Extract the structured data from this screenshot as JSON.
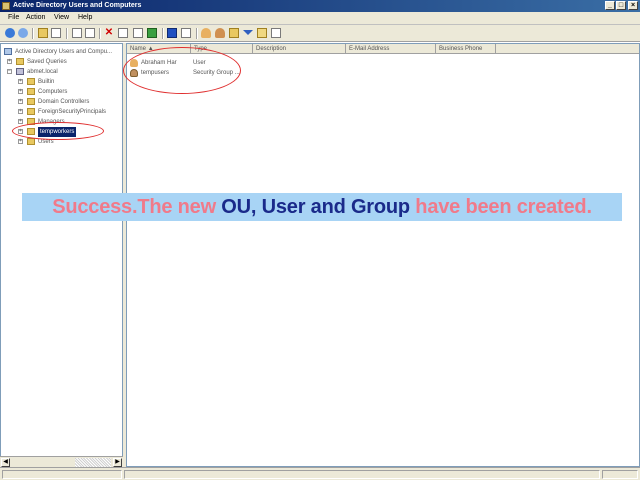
{
  "window": {
    "title": "Active Directory Users and Computers",
    "controls": {
      "minimize": "_",
      "maximize": "□",
      "close": "×"
    }
  },
  "menu": {
    "file": "File",
    "action": "Action",
    "view": "View",
    "help": "Help"
  },
  "toolbar": {
    "icons": [
      "back-arrow-icon",
      "forward-arrow-icon",
      "up-folder-icon",
      "tree-icon",
      "refresh-icon",
      "cut-icon",
      "copy-icon",
      "delete-icon",
      "properties-icon",
      "export-icon",
      "refresh2-icon",
      "help-icon",
      "console-icon",
      "new-user-icon",
      "new-group-icon",
      "new-ou-icon",
      "filter-icon",
      "find-icon",
      "move-icon"
    ]
  },
  "tree": {
    "root": "Active Directory Users and Compu...",
    "items": [
      {
        "label": "Saved Queries",
        "level": 1
      },
      {
        "label": "abmet.local",
        "level": 1
      },
      {
        "label": "Builtin",
        "level": 2
      },
      {
        "label": "Computers",
        "level": 2
      },
      {
        "label": "Domain Controllers",
        "level": 2
      },
      {
        "label": "ForeignSecurityPrincipals",
        "level": 2
      },
      {
        "label": "Managers",
        "level": 2
      },
      {
        "label": "tempworkers",
        "level": 2,
        "selected": true
      },
      {
        "label": "Users",
        "level": 2
      }
    ]
  },
  "list": {
    "columns": [
      "Name",
      "Type",
      "Description",
      "E-Mail Address",
      "Business Phone"
    ],
    "rows": [
      {
        "name": "Abraham Har",
        "type": "User",
        "icon": "user-icon"
      },
      {
        "name": "tempusers",
        "type": "Security Group ...",
        "icon": "group-icon"
      }
    ]
  },
  "banner": {
    "part1": "Success.The new ",
    "part2": "OU, User and Group",
    "part3": " have been created.",
    "colors": {
      "pink": "#f07a8a",
      "navy": "#1a2a8a",
      "background": "#a8d4f5"
    }
  },
  "colors": {
    "title_bar": "#0a246a",
    "selection": "#0a246a",
    "annotation": "#e03030",
    "chrome": "#ece9d8"
  }
}
